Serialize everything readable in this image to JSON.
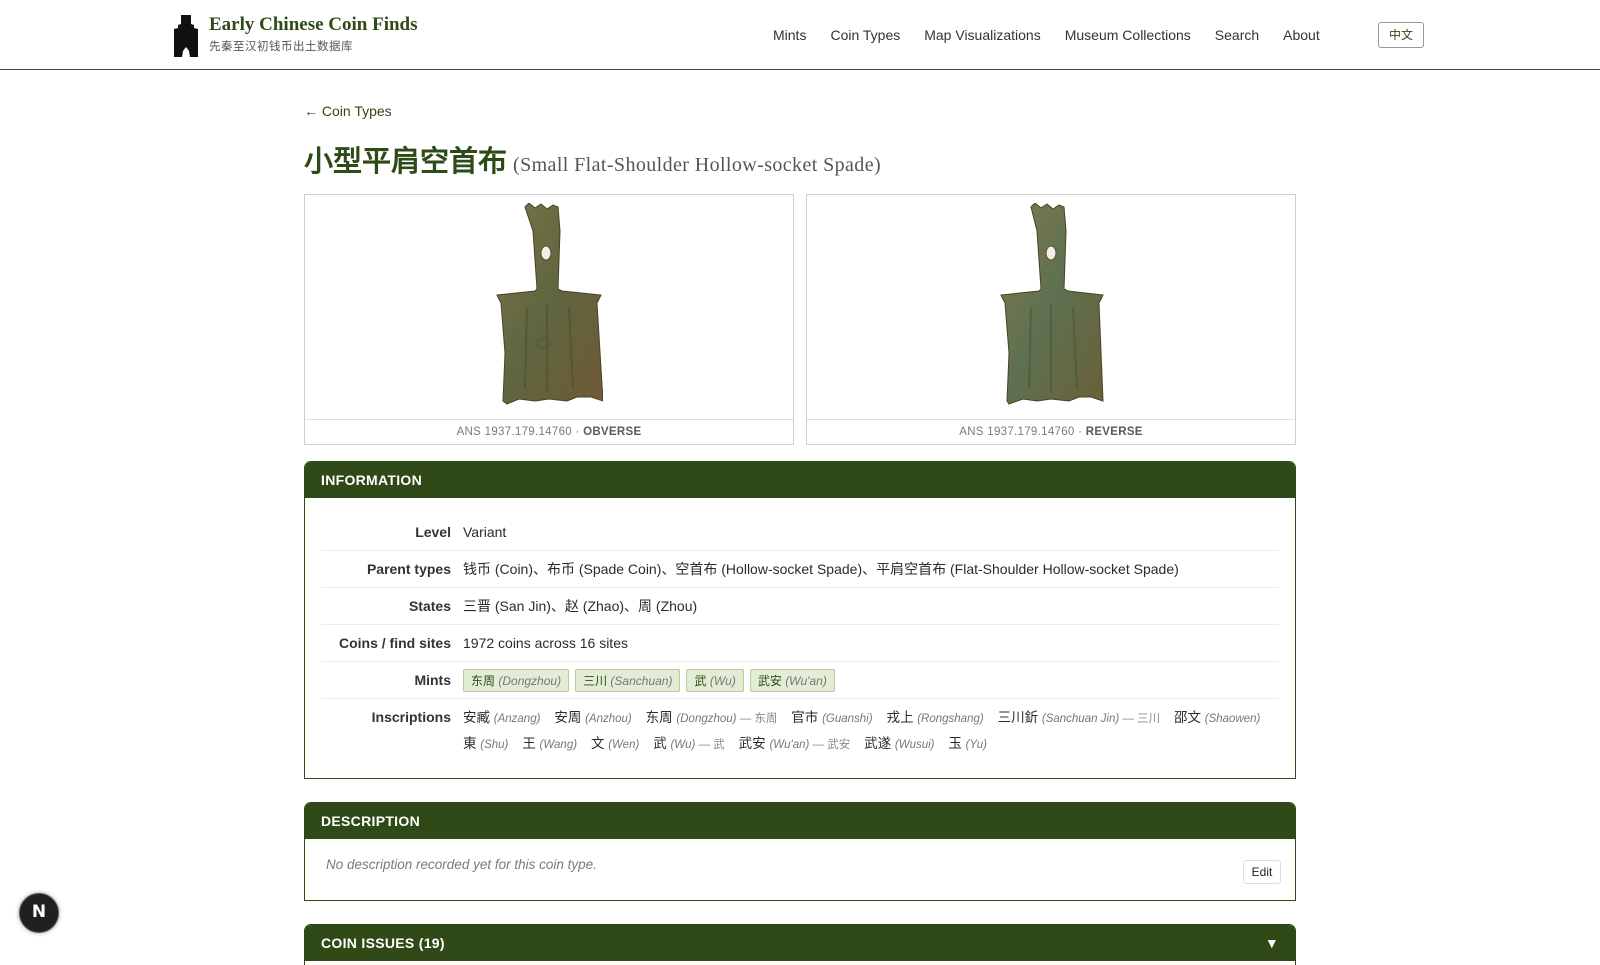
{
  "site": {
    "title": "Early Chinese Coin Finds",
    "subtitle": "先秦至汉初钱币出土数据库",
    "lang_button": "中文"
  },
  "nav": [
    {
      "label": "Mints"
    },
    {
      "label": "Coin Types"
    },
    {
      "label": "Map Visualizations"
    },
    {
      "label": "Museum Collections"
    },
    {
      "label": "Search"
    },
    {
      "label": "About"
    }
  ],
  "back_link": "← Coin Types",
  "title": {
    "zh": "小型平肩空首布",
    "en": "(Small Flat-Shoulder Hollow-socket Spade)"
  },
  "images": {
    "obverse": {
      "id": "ANS 1937.179.14760 · ",
      "side": "OBVERSE"
    },
    "reverse": {
      "id": "ANS 1937.179.14760 · ",
      "side": "REVERSE"
    },
    "coin_color": "#6b6a45"
  },
  "information": {
    "heading": "INFORMATION",
    "rows": {
      "level": {
        "label": "Level",
        "value": "Variant"
      },
      "parent_types": {
        "label": "Parent types",
        "value": "钱币 (Coin)、布币 (Spade Coin)、空首布 (Hollow-socket Spade)、平肩空首布 (Flat-Shoulder Hollow-socket Spade)"
      },
      "states": {
        "label": "States",
        "value": "三晋 (San Jin)、赵 (Zhao)、周 (Zhou)"
      },
      "coins": {
        "label": "Coins / find sites",
        "value": "1972 coins across 16 sites"
      },
      "mints": {
        "label": "Mints"
      },
      "inscriptions": {
        "label": "Inscriptions"
      }
    },
    "mints": [
      {
        "zh": "东周",
        "en": "(Dongzhou)"
      },
      {
        "zh": "三川",
        "en": "(Sanchuan)"
      },
      {
        "zh": "武",
        "en": "(Wu)"
      },
      {
        "zh": "武安",
        "en": "(Wu'an)"
      }
    ],
    "inscriptions": [
      {
        "zh": "安臧",
        "en": "(Anzang)",
        "alt": ""
      },
      {
        "zh": "安周",
        "en": "(Anzhou)",
        "alt": ""
      },
      {
        "zh": "东周",
        "en": "(Dongzhou)",
        "alt": " — 东周"
      },
      {
        "zh": "官市",
        "en": "(Guanshi)",
        "alt": ""
      },
      {
        "zh": "戎上",
        "en": "(Rongshang)",
        "alt": ""
      },
      {
        "zh": "三川釿",
        "en": "(Sanchuan Jin)",
        "alt": " — 三川"
      },
      {
        "zh": "邵文",
        "en": "(Shaowen)",
        "alt": ""
      },
      {
        "zh": "東",
        "en": "(Shu)",
        "alt": ""
      },
      {
        "zh": "王",
        "en": "(Wang)",
        "alt": ""
      },
      {
        "zh": "文",
        "en": "(Wen)",
        "alt": ""
      },
      {
        "zh": "武",
        "en": "(Wu)",
        "alt": " — 武"
      },
      {
        "zh": "武安",
        "en": "(Wu'an)",
        "alt": " — 武安"
      },
      {
        "zh": "武遂",
        "en": "(Wusui)",
        "alt": ""
      },
      {
        "zh": "玉",
        "en": "(Yu)",
        "alt": ""
      }
    ]
  },
  "description": {
    "heading": "DESCRIPTION",
    "text": "No description recorded yet for this coin type.",
    "edit": "Edit"
  },
  "issues": {
    "heading": "COIN ISSUES (19)",
    "toggle": "▼"
  },
  "fab": "N",
  "colors": {
    "brand_green": "#2f4a17",
    "tag_bg": "#e3edd6"
  }
}
